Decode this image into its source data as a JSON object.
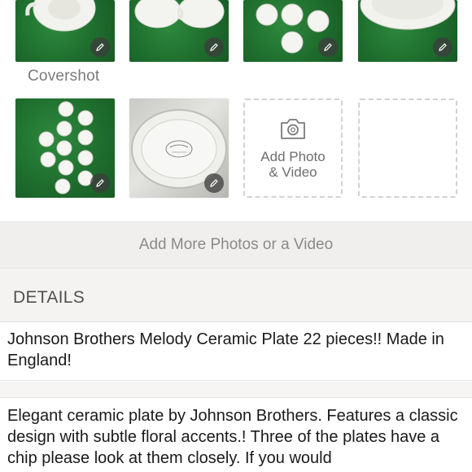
{
  "photos": {
    "cover_label": "Covershot",
    "items": [
      {
        "icon": "teapot-photo",
        "editable": true
      },
      {
        "icon": "cups-photo",
        "editable": true
      },
      {
        "icon": "plates-photo",
        "editable": true
      },
      {
        "icon": "bowl-photo",
        "editable": true
      },
      {
        "icon": "small-plates-photo",
        "editable": true
      },
      {
        "icon": "platter-backstamp-photo",
        "editable": true
      }
    ],
    "add_tile_label": "Add Photo\n& Video"
  },
  "add_more_label": "Add More Photos or a Video",
  "details": {
    "header": "DETAILS",
    "title": "Johnson Brothers Melody Ceramic Plate 22 pieces!! Made in England!",
    "description": "Elegant ceramic plate by Johnson Brothers. Features a classic design with subtle floral accents.! Three of the plates have a chip please look at them closely. If you would"
  },
  "colors": {
    "felt_green": "#1f6e2e",
    "panel_grey": "#f1efee",
    "muted_text": "#8a8a8a"
  }
}
